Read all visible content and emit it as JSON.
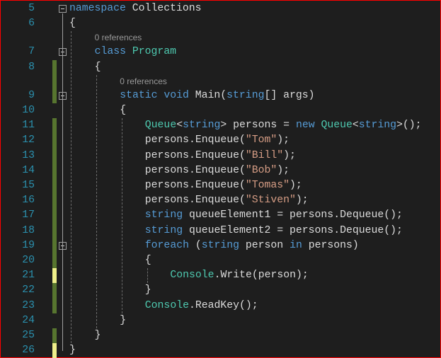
{
  "editor": {
    "colors": {
      "keyword": "#569cd6",
      "type": "#4ec9b0",
      "string": "#d69d85",
      "text": "#dcdcdc",
      "line_number": "#2b91af",
      "changed_saved": "#57752f",
      "changed_unsaved": "#eff08a"
    },
    "lines": [
      {
        "n": "5",
        "indent": 0,
        "fold": true,
        "change": "",
        "tokens": [
          [
            "k",
            "namespace"
          ],
          [
            "p",
            " Collections"
          ]
        ]
      },
      {
        "n": "6",
        "indent": 0,
        "change": "",
        "tokens": [
          [
            "p",
            "{"
          ]
        ]
      },
      {
        "lens": "0 references",
        "indent": 4
      },
      {
        "n": "7",
        "indent": 4,
        "fold": true,
        "change": "",
        "tokens": [
          [
            "k",
            "class"
          ],
          [
            "p",
            " "
          ],
          [
            "t",
            "Program"
          ]
        ]
      },
      {
        "n": "8",
        "indent": 4,
        "change": "saved",
        "tokens": [
          [
            "p",
            "{"
          ]
        ]
      },
      {
        "lens": "0 references",
        "indent": 8,
        "change": "saved"
      },
      {
        "n": "9",
        "indent": 8,
        "fold": true,
        "change": "saved",
        "tokens": [
          [
            "k",
            "static"
          ],
          [
            "p",
            " "
          ],
          [
            "k",
            "void"
          ],
          [
            "p",
            " Main("
          ],
          [
            "k",
            "string"
          ],
          [
            "p",
            "[] args)"
          ]
        ]
      },
      {
        "n": "10",
        "indent": 8,
        "change": "",
        "tokens": [
          [
            "p",
            "{"
          ]
        ]
      },
      {
        "n": "11",
        "indent": 12,
        "change": "saved",
        "tokens": [
          [
            "t",
            "Queue"
          ],
          [
            "p",
            "<"
          ],
          [
            "k",
            "string"
          ],
          [
            "p",
            "> persons = "
          ],
          [
            "k",
            "new"
          ],
          [
            "p",
            " "
          ],
          [
            "t",
            "Queue"
          ],
          [
            "p",
            "<"
          ],
          [
            "k",
            "string"
          ],
          [
            "p",
            ">();"
          ]
        ]
      },
      {
        "n": "12",
        "indent": 12,
        "change": "saved",
        "tokens": [
          [
            "p",
            "persons.Enqueue("
          ],
          [
            "s",
            "\"Tom\""
          ],
          [
            "p",
            ");"
          ]
        ]
      },
      {
        "n": "13",
        "indent": 12,
        "change": "saved",
        "tokens": [
          [
            "p",
            "persons.Enqueue("
          ],
          [
            "s",
            "\"Bill\""
          ],
          [
            "p",
            ");"
          ]
        ]
      },
      {
        "n": "14",
        "indent": 12,
        "change": "saved",
        "tokens": [
          [
            "p",
            "persons.Enqueue("
          ],
          [
            "s",
            "\"Bob\""
          ],
          [
            "p",
            ");"
          ]
        ]
      },
      {
        "n": "15",
        "indent": 12,
        "change": "saved",
        "tokens": [
          [
            "p",
            "persons.Enqueue("
          ],
          [
            "s",
            "\"Tomas\""
          ],
          [
            "p",
            ");"
          ]
        ]
      },
      {
        "n": "16",
        "indent": 12,
        "change": "saved",
        "tokens": [
          [
            "p",
            "persons.Enqueue("
          ],
          [
            "s",
            "\"Stiven\""
          ],
          [
            "p",
            ");"
          ]
        ]
      },
      {
        "n": "17",
        "indent": 12,
        "change": "saved",
        "tokens": [
          [
            "k",
            "string"
          ],
          [
            "p",
            " queueElement1 = persons.Dequeue();"
          ]
        ]
      },
      {
        "n": "18",
        "indent": 12,
        "change": "saved",
        "tokens": [
          [
            "k",
            "string"
          ],
          [
            "p",
            " queueElement2 = persons.Dequeue();"
          ]
        ]
      },
      {
        "n": "19",
        "indent": 12,
        "fold": true,
        "change": "saved",
        "tokens": [
          [
            "k",
            "foreach"
          ],
          [
            "p",
            " ("
          ],
          [
            "k",
            "string"
          ],
          [
            "p",
            " person "
          ],
          [
            "k",
            "in"
          ],
          [
            "p",
            " persons)"
          ]
        ]
      },
      {
        "n": "20",
        "indent": 12,
        "change": "saved",
        "tokens": [
          [
            "p",
            "{"
          ]
        ]
      },
      {
        "n": "21",
        "indent": 16,
        "change": "unsaved",
        "tokens": [
          [
            "t",
            "Console"
          ],
          [
            "p",
            ".Write(person);"
          ]
        ]
      },
      {
        "n": "22",
        "indent": 12,
        "change": "saved",
        "tokens": [
          [
            "p",
            "}"
          ]
        ]
      },
      {
        "n": "23",
        "indent": 12,
        "change": "saved",
        "tokens": [
          [
            "t",
            "Console"
          ],
          [
            "p",
            ".ReadKey();"
          ]
        ]
      },
      {
        "n": "24",
        "indent": 8,
        "change": "",
        "tokens": [
          [
            "p",
            "}"
          ]
        ]
      },
      {
        "n": "25",
        "indent": 4,
        "change": "saved",
        "tokens": [
          [
            "p",
            "}"
          ]
        ]
      },
      {
        "n": "26",
        "indent": 0,
        "change": "unsaved",
        "tokens": [
          [
            "p",
            "}"
          ]
        ]
      }
    ]
  }
}
